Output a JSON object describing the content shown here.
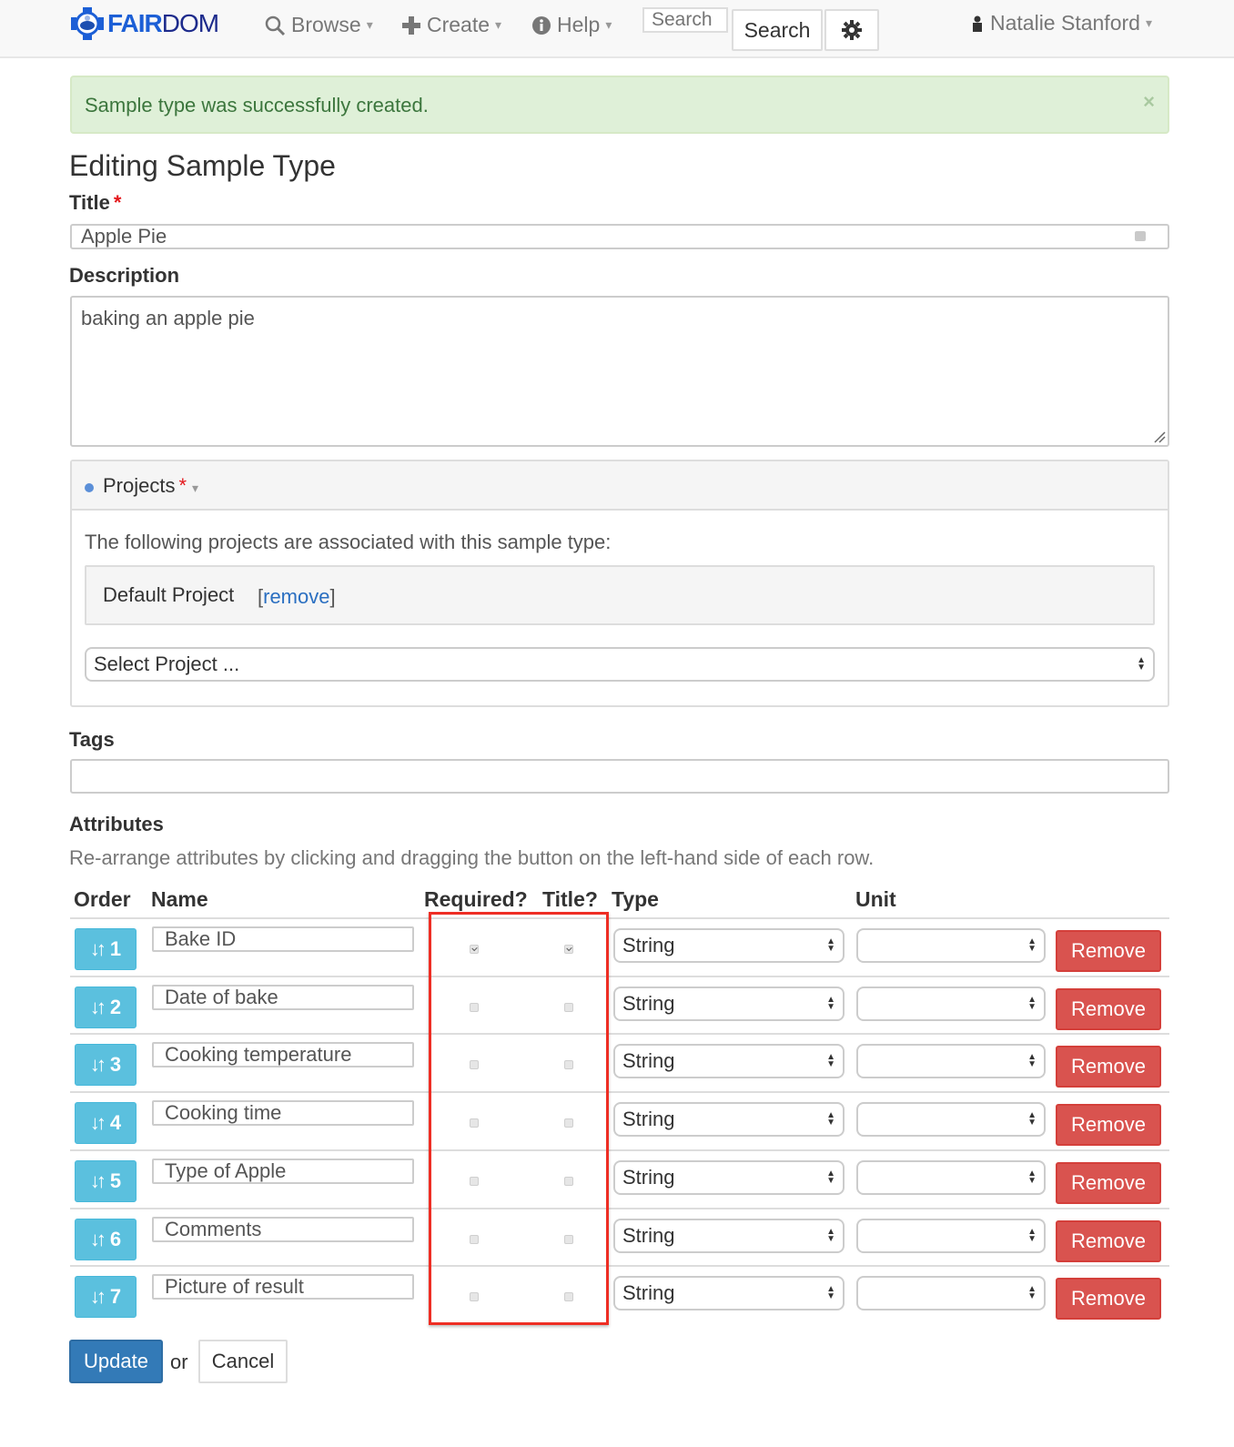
{
  "navbar": {
    "brand": {
      "part1": "FAIR",
      "part2": "DOM",
      "colors": {
        "fair": "#1c5fd6",
        "dom": "#1d2b8c"
      }
    },
    "items": [
      {
        "label": "Browse",
        "icon": "search-icon"
      },
      {
        "label": "Create",
        "icon": "plus-icon"
      },
      {
        "label": "Help",
        "icon": "info-circle-icon"
      }
    ],
    "search": {
      "placeholder": "Search",
      "button_label": "Search"
    },
    "settings_icon": "gear-icon",
    "user": {
      "name": "Natalie Stanford",
      "icon": "user-icon"
    }
  },
  "alert": {
    "message": "Sample type was successfully created.",
    "close": "×",
    "color": "#3c763d"
  },
  "page": {
    "title": "Editing Sample Type"
  },
  "form": {
    "title": {
      "label": "Title",
      "required_mark": "*",
      "value": "Apple Pie"
    },
    "description": {
      "label": "Description",
      "value": "baking an apple pie"
    },
    "projects": {
      "label": "Projects",
      "required_mark": "*",
      "intro": "The following projects are associated with this sample type:",
      "associated": [
        {
          "name": "Default Project",
          "remove_label": "remove"
        }
      ],
      "select_placeholder": "Select Project ..."
    },
    "tags": {
      "label": "Tags",
      "value": ""
    },
    "attributes": {
      "heading": "Attributes",
      "help": "Re-arrange attributes by clicking and dragging the button on the left-hand side of each row.",
      "columns": {
        "order": "Order",
        "name": "Name",
        "required": "Required?",
        "title": "Title?",
        "type": "Type",
        "unit": "Unit"
      },
      "remove_label": "Remove",
      "rows": [
        {
          "order": "1",
          "name": "Bake ID",
          "required": true,
          "title": true,
          "type": "String",
          "unit": ""
        },
        {
          "order": "2",
          "name": "Date of bake",
          "required": false,
          "title": false,
          "type": "String",
          "unit": ""
        },
        {
          "order": "3",
          "name": "Cooking temperature",
          "required": false,
          "title": false,
          "type": "String",
          "unit": ""
        },
        {
          "order": "4",
          "name": "Cooking time",
          "required": false,
          "title": false,
          "type": "String",
          "unit": ""
        },
        {
          "order": "5",
          "name": "Type of Apple",
          "required": false,
          "title": false,
          "type": "String",
          "unit": ""
        },
        {
          "order": "6",
          "name": "Comments",
          "required": false,
          "title": false,
          "type": "String",
          "unit": ""
        },
        {
          "order": "7",
          "name": "Picture of result",
          "required": false,
          "title": false,
          "type": "String",
          "unit": ""
        }
      ]
    },
    "actions": {
      "update_label": "Update",
      "or_text": "or",
      "cancel_label": "Cancel"
    }
  }
}
